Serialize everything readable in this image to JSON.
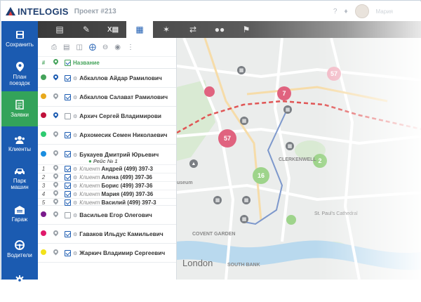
{
  "header": {
    "logo_text": "INTELOGIS",
    "project": "Проект #213",
    "user_name": "Мария"
  },
  "nav": {
    "items": [
      {
        "label": "Сохранить",
        "icon": "save-icon"
      },
      {
        "label": "План поездок",
        "icon": "location-pin-icon"
      },
      {
        "label": "Заявки",
        "icon": "document-icon",
        "active": true
      },
      {
        "label": "Клиенты",
        "icon": "users-icon"
      },
      {
        "label": "Парк машин",
        "icon": "car-icon"
      },
      {
        "label": "Гараж",
        "icon": "garage-icon"
      },
      {
        "label": "Водители",
        "icon": "steering-wheel-icon"
      },
      {
        "label": "Настройки",
        "icon": "gear-icon"
      }
    ]
  },
  "toolbar": {
    "icons": [
      "document-list-icon",
      "edit-document-icon",
      "excel-icon",
      "grid-icon",
      "route-nodes-icon",
      "swap-arrows-icon",
      "users-group-icon",
      "flag-icon"
    ]
  },
  "list": {
    "columns": {
      "num": "#",
      "name": "Название"
    },
    "tools": [
      "print-icon",
      "excel-icon",
      "archive-icon",
      "add-icon",
      "remove-icon",
      "eye-icon",
      "more-icon"
    ],
    "rows": [
      {
        "color": "#44a35a",
        "pin": "blue",
        "checked": true,
        "name": "Абкаллов Айдар Рамилович"
      },
      {
        "color": "#e8a91c",
        "pin": "grey",
        "checked": true,
        "name": "Абкаллов Салават Рамилович"
      },
      {
        "color": "#c0123b",
        "pin": "blue",
        "checked": false,
        "name": "Архич Сергей Владимирови"
      },
      {
        "color": "#2ecb71",
        "pin": "grey",
        "checked": true,
        "name": "Архомесик Семен Николаевич"
      },
      {
        "color": "#1a8ee0",
        "pin": "grey",
        "checked": true,
        "name": "Букауев Дмитрий Юрьевич",
        "trip": "Рейс № 1",
        "clients": [
          {
            "num": "1",
            "prefix": "Клиент",
            "name": "Андрей (499) 397-3"
          },
          {
            "num": "2",
            "prefix": "Клиент",
            "name": "Алена (499) 397-36"
          },
          {
            "num": "3",
            "prefix": "Клиент",
            "name": "Борис (499) 397-36"
          },
          {
            "num": "4",
            "prefix": "Клиент",
            "name": "Мария (499) 397-36"
          },
          {
            "num": "5",
            "prefix": "Клиент",
            "name": "Василий (499) 397-3"
          }
        ]
      },
      {
        "color": "#7a1a8c",
        "pin": "grey",
        "checked": false,
        "name": "Васильев Егор Олегович"
      },
      {
        "color": "#e0196b",
        "pin": "grey",
        "checked": true,
        "name": "Гаваков Ильдус Камильевич"
      },
      {
        "color": "#f2e21a",
        "pin": "grey",
        "checked": true,
        "name": "Жаркич Владимир Сергеевич"
      }
    ]
  },
  "map": {
    "clusters": [
      {
        "value": "57",
        "color": "#e0637f"
      },
      {
        "value": "57",
        "color": "#f2b7c4"
      },
      {
        "value": "7",
        "color": "#e0637f"
      },
      {
        "value": "16",
        "color": "#9ed48b"
      },
      {
        "value": "2",
        "color": "#9ed48b"
      }
    ],
    "labels": {
      "covent": "COVENT GARDEN",
      "london": "London",
      "southbank": "SOUTH BANK",
      "clerkenwell": "CLERKENWELL",
      "pauls": "St. Paul's Cathedral",
      "museum": "useum"
    }
  }
}
